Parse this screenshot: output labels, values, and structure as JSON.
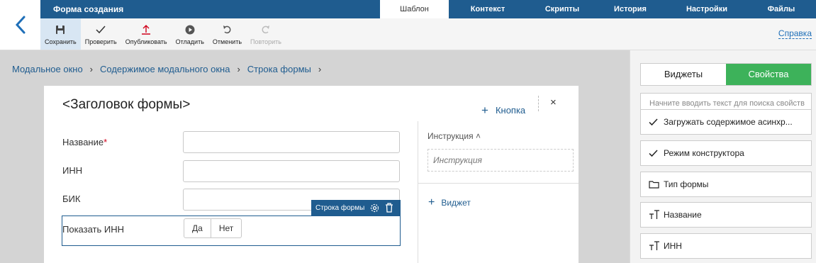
{
  "header": {
    "title": "Форма создания",
    "tabs": [
      "Шаблон",
      "Контекст",
      "Скрипты",
      "История",
      "Настройки",
      "Файлы"
    ]
  },
  "toolbar": {
    "save": "Сохранить",
    "check": "Проверить",
    "publish": "Опубликовать",
    "debug": "Отладить",
    "undo": "Отменить",
    "redo": "Повторить",
    "help": "Справка"
  },
  "breadcrumbs": [
    "Модальное окно",
    "Содержимое модального окна",
    "Строка формы"
  ],
  "modal": {
    "title": "<Заголовок формы>",
    "add_button": "Кнопка",
    "close": "×",
    "fields": [
      {
        "label": "Название",
        "required": "*"
      },
      {
        "label": "ИНН"
      },
      {
        "label": "БИК"
      }
    ],
    "row_tag": "Строка формы",
    "toggle_label": "Показать ИНН",
    "yes": "Да",
    "no": "Нет",
    "instruction_header": "Инструкция",
    "instruction_placeholder": "Инструкция",
    "add_widget": "Виджет"
  },
  "panel": {
    "tabs": [
      "Виджеты",
      "Свойства"
    ],
    "search_placeholder": "Начните вводить текст для поиска свойств",
    "items": [
      {
        "label": "Загружать содержимое асинхр...",
        "icon": "check-icon"
      },
      {
        "label": "Режим конструктора",
        "icon": "check-icon"
      },
      {
        "label": "Тип формы",
        "icon": "folder-icon"
      },
      {
        "label": "Название",
        "icon": "text-icon"
      },
      {
        "label": "ИНН",
        "icon": "text-icon"
      }
    ]
  },
  "colors": {
    "header": "#1f5c8f",
    "accent_green": "#3db25a",
    "link": "#1f5c8f"
  }
}
